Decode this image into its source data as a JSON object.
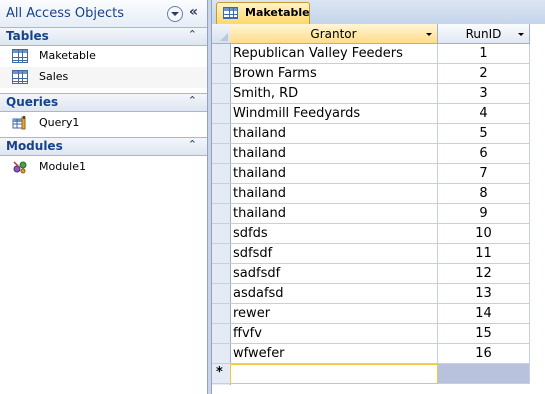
{
  "nav": {
    "title": "All Access Objects",
    "collapse_glyph": "«",
    "groups": [
      {
        "label": "Tables",
        "items": [
          {
            "label": "Maketable",
            "icon": "table-icon"
          },
          {
            "label": "Sales",
            "icon": "table-icon"
          }
        ]
      },
      {
        "label": "Queries",
        "items": [
          {
            "label": "Query1",
            "icon": "query-icon"
          }
        ]
      },
      {
        "label": "Modules",
        "items": [
          {
            "label": "Module1",
            "icon": "module-icon"
          }
        ]
      }
    ],
    "group_chevron": "⌃"
  },
  "document": {
    "tab_label": "Maketable",
    "columns": [
      "Grantor",
      "RunID"
    ],
    "rows": [
      {
        "grantor": "Republican Valley Feeders",
        "runid": "1"
      },
      {
        "grantor": "Brown Farms",
        "runid": "2"
      },
      {
        "grantor": "Smith, RD",
        "runid": "3"
      },
      {
        "grantor": "Windmill Feedyards",
        "runid": "4"
      },
      {
        "grantor": "thailand",
        "runid": "5"
      },
      {
        "grantor": "thailand",
        "runid": "6"
      },
      {
        "grantor": "thailand",
        "runid": "7"
      },
      {
        "grantor": "thailand",
        "runid": "8"
      },
      {
        "grantor": "thailand",
        "runid": "9"
      },
      {
        "grantor": "sdfds",
        "runid": "10"
      },
      {
        "grantor": "sdfsdf",
        "runid": "11"
      },
      {
        "grantor": "sadfsdf",
        "runid": "12"
      },
      {
        "grantor": "asdafsd",
        "runid": "13"
      },
      {
        "grantor": "rewer",
        "runid": "14"
      },
      {
        "grantor": "ffvfv",
        "runid": "15"
      },
      {
        "grantor": "wfwefer",
        "runid": "16"
      }
    ],
    "new_record_marker": "*"
  },
  "colors": {
    "accent": "#15428b",
    "active_tab": "#ffd86a",
    "selected_new_cell_border": "#f4c542"
  }
}
